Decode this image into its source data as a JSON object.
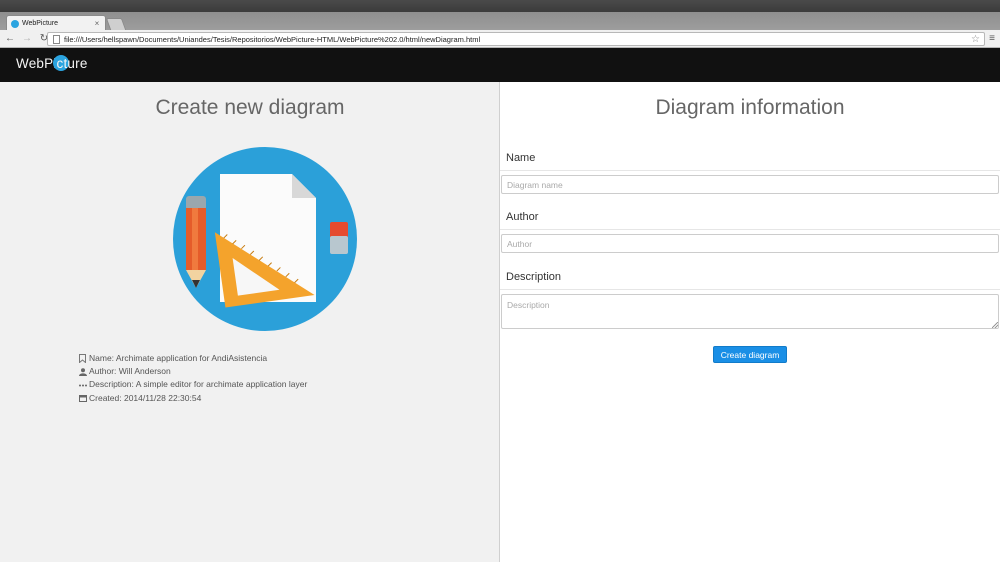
{
  "browser": {
    "tab_title": "WebPicture",
    "tab_close": "×",
    "url": "file:///Users/hellspawn/Documents/Uniandes/Tesis/Repositorios/WebPicture-HTML/WebPicture%202.0/html/newDiagram.html"
  },
  "navbar": {
    "brand_part1": "WebPi",
    "brand_part2": "c",
    "brand_part3": "ture",
    "brand_accent_color": "#2ba4e0"
  },
  "left_panel": {
    "title": "Create new diagram",
    "illustration_icon": "diagram-tools-illustration",
    "info": {
      "name": "Name: Archimate application for AndiAsistencia",
      "author": "Author: Will Anderson",
      "description": "Description: A simple editor for archimate application layer",
      "created": "Created: 2014/11/28 22:30:54"
    }
  },
  "right_panel": {
    "title": "Diagram information",
    "name_label": "Name",
    "name_placeholder": "Diagram name",
    "author_label": "Author",
    "author_placeholder": "Author",
    "description_label": "Description",
    "description_placeholder": "Description",
    "create_button": "Create diagram",
    "button_color": "#1a8fe6"
  }
}
